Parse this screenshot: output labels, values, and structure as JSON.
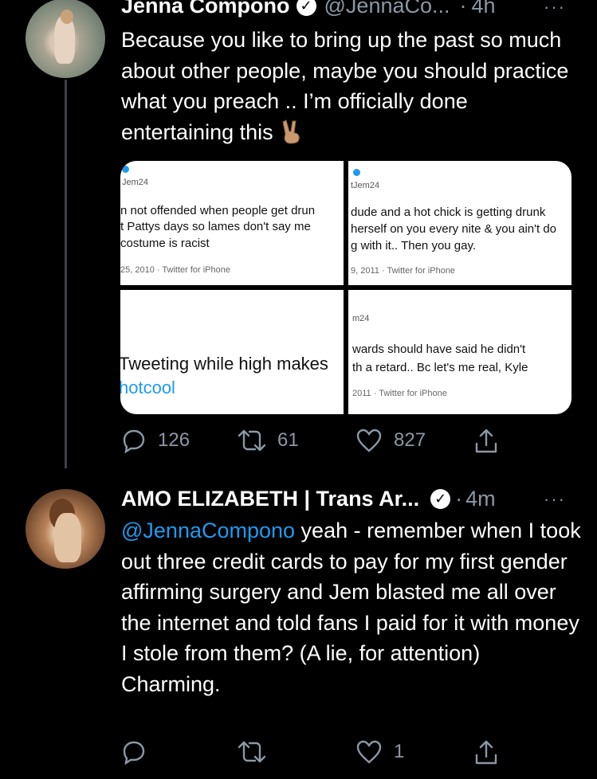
{
  "tweet1": {
    "name": "Jenna Compono",
    "handle": "@JennaCo...",
    "dot": "·",
    "time": "4h",
    "more": "···",
    "text": "Because you like to bring up the past so much about other people, maybe you should practice what you preach .. I’m officially done entertaining this",
    "emoji": "victory-hand-emoji",
    "media": {
      "shot1": {
        "handle": "Jem24",
        "line1": "n not offended when people get drun",
        "line2": "t Pattys days so lames don't say me",
        "line3": "costume is racist",
        "meta": "25, 2010 · Twitter for iPhone"
      },
      "shot2": {
        "handle": "tJem24",
        "line1": "dude and a hot chick is getting drunk",
        "line2": "herself on you every nite & you ain't do",
        "line3": "g with it.. Then you gay.",
        "meta": "9, 2011 · Twitter for iPhone"
      },
      "shot3": {
        "line1": "Tweeting while high makes",
        "line2": "hotcool"
      },
      "shot4": {
        "handle": "m24",
        "line1": "wards should have said he didn't",
        "line2": "th a retard.. Bc let's me real, Kyle",
        "meta": "2011 · Twitter for iPhone"
      }
    },
    "actions": {
      "replies": "126",
      "retweets": "61",
      "likes": "827"
    }
  },
  "tweet2": {
    "name": "AMO ELIZABETH | Trans Ar...",
    "dot": "·",
    "time": "4m",
    "more": "···",
    "mention": "@JennaCompono",
    "text": " yeah - remember when I took out three credit cards to pay for my first gender affirming surgery and Jem blasted me all over the internet and told fans I paid for it with money I stole from them? (A lie, for attention) Charming.",
    "actions": {
      "likes": "1"
    }
  },
  "colors": {
    "background": "#000000",
    "text": "#ffffff",
    "secondary": "#8b98a5",
    "link": "#1d9bf0",
    "thread_line": "#3d4248"
  }
}
